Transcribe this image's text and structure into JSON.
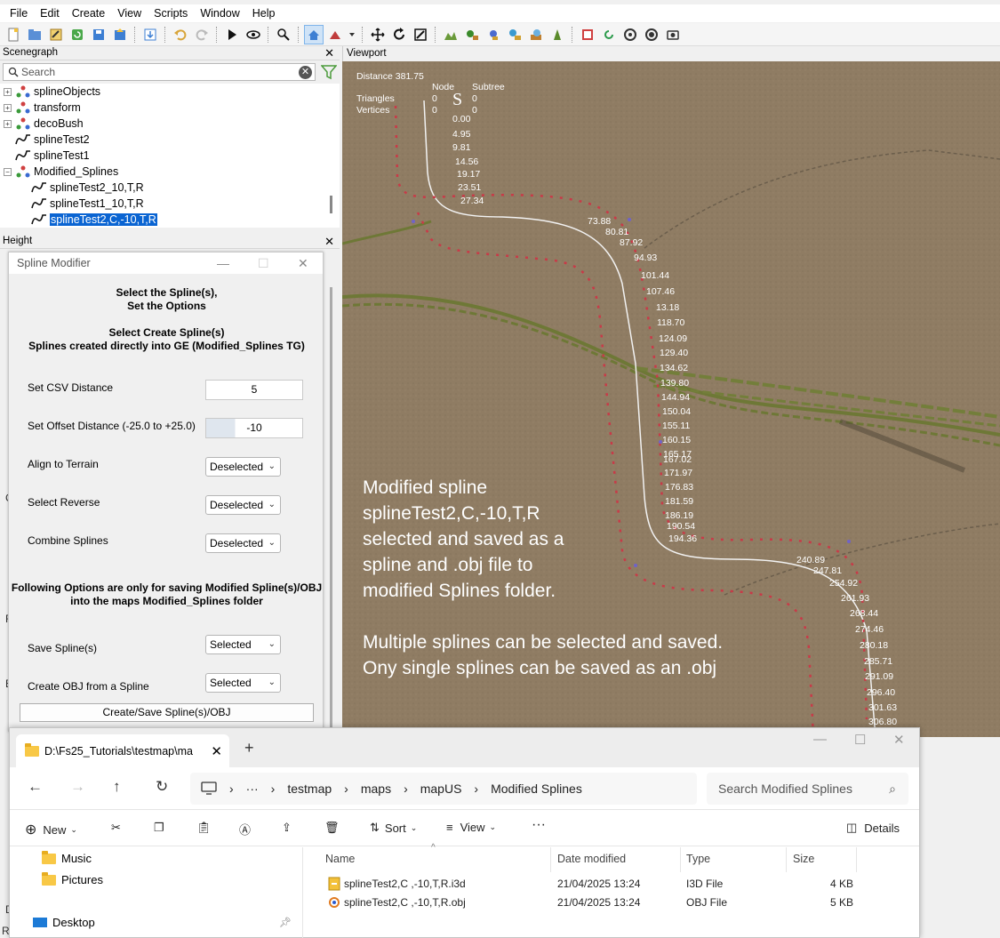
{
  "menu": [
    "File",
    "Edit",
    "Create",
    "View",
    "Scripts",
    "Window",
    "Help"
  ],
  "panels": {
    "scenegraph": "Scenegraph",
    "height": "Height",
    "viewport": "Viewport"
  },
  "scenegraph": {
    "search_placeholder": "Search",
    "items": [
      {
        "label": "splineObjects"
      },
      {
        "label": "transform"
      },
      {
        "label": "decoBush"
      },
      {
        "label": "splineTest2"
      },
      {
        "label": "splineTest1"
      },
      {
        "label": "Modified_Splines"
      },
      {
        "label": "splineTest2_10,T,R"
      },
      {
        "label": "splineTest1_10,T,R"
      },
      {
        "label": "splineTest2,C,-10,T,R"
      }
    ]
  },
  "modifier": {
    "title": "Spline Modifier",
    "heading1": "Select the Spline(s),",
    "heading2": "Set the Options",
    "heading3": "Select Create Spline(s)",
    "heading4": "Splines created directly into GE (Modified_Splines TG)",
    "csv_label": "Set CSV Distance",
    "csv_value": "5",
    "offset_label": "Set Offset Distance (-25.0 to +25.0)",
    "offset_value": "-10",
    "align_label": "Align to Terrain",
    "align_value": "Deselected",
    "reverse_label": "Select Reverse",
    "reverse_value": "Deselected",
    "combine_label": "Combine Splines",
    "combine_value": "Deselected",
    "options_note1": "Following Options are only for saving Modified Spline(s)/OBJ",
    "options_note2": "into the maps Modified_Splines folder",
    "save_label": "Save Spline(s)",
    "save_value": "Selected",
    "obj_label": "Create OBJ from a Spline",
    "obj_value": "Selected",
    "create_button": "Create/Save Spline(s)/OBJ"
  },
  "viewport": {
    "distance": "Distance 381.75",
    "stats": {
      "node": "Node",
      "subtree": "Subtree",
      "triangles": "Triangles",
      "vertices": "Vertices",
      "tri_node": "0",
      "tri_sub": "0",
      "vert_node": "0",
      "vert_sub": "0",
      "marker": "S"
    },
    "distance_labels_upper": [
      "0.00",
      "4.95",
      "9.81",
      "14.56",
      "19.17",
      "23.51",
      "27.34",
      "73.88",
      "80.81",
      "87.92",
      "94.93",
      "101.44",
      "107.46",
      "13.18",
      "118.70",
      "124.09",
      "129.40",
      "134.62",
      "139.80",
      "144.94",
      "150.04",
      "155.11",
      "160.15",
      "165.17",
      "167.02",
      "171.97",
      "176.83",
      "181.59",
      "186.19",
      "190.54",
      "194.36"
    ],
    "distance_labels_lower": [
      "240.89",
      "247.81",
      "254.92",
      "261.93",
      "268.44",
      "274.46",
      "280.18",
      "285.71",
      "291.09",
      "296.40",
      "301.63",
      "306.80"
    ],
    "annotation": [
      "Modified spline",
      "splineTest2,C,-10,T,R",
      "selected and saved as a",
      "spline and .obj file to",
      "modified Splines folder.",
      "",
      "Multiple splines can be selected and saved.",
      "Ony single splines can be saved as an .obj"
    ]
  },
  "explorer": {
    "tab_title": "D:\\Fs25_Tutorials\\testmap\\ma",
    "breadcrumb": [
      "testmap",
      "maps",
      "mapUS",
      "Modified Splines"
    ],
    "search_placeholder": "Search Modified Splines",
    "commands": {
      "new": "New",
      "sort": "Sort",
      "view": "View",
      "details": "Details"
    },
    "nav_items": [
      "Music",
      "Pictures",
      "Desktop"
    ],
    "columns": [
      "Name",
      "Date modified",
      "Type",
      "Size"
    ],
    "files": [
      {
        "name": "splineTest2,C ,-10,T,R.i3d",
        "date": "21/04/2025 13:24",
        "type": "I3D File",
        "size": "4 KB"
      },
      {
        "name": "splineTest2,C ,-10,T,R.obj",
        "date": "21/04/2025 13:24",
        "type": "OBJ File",
        "size": "5 KB"
      }
    ]
  }
}
